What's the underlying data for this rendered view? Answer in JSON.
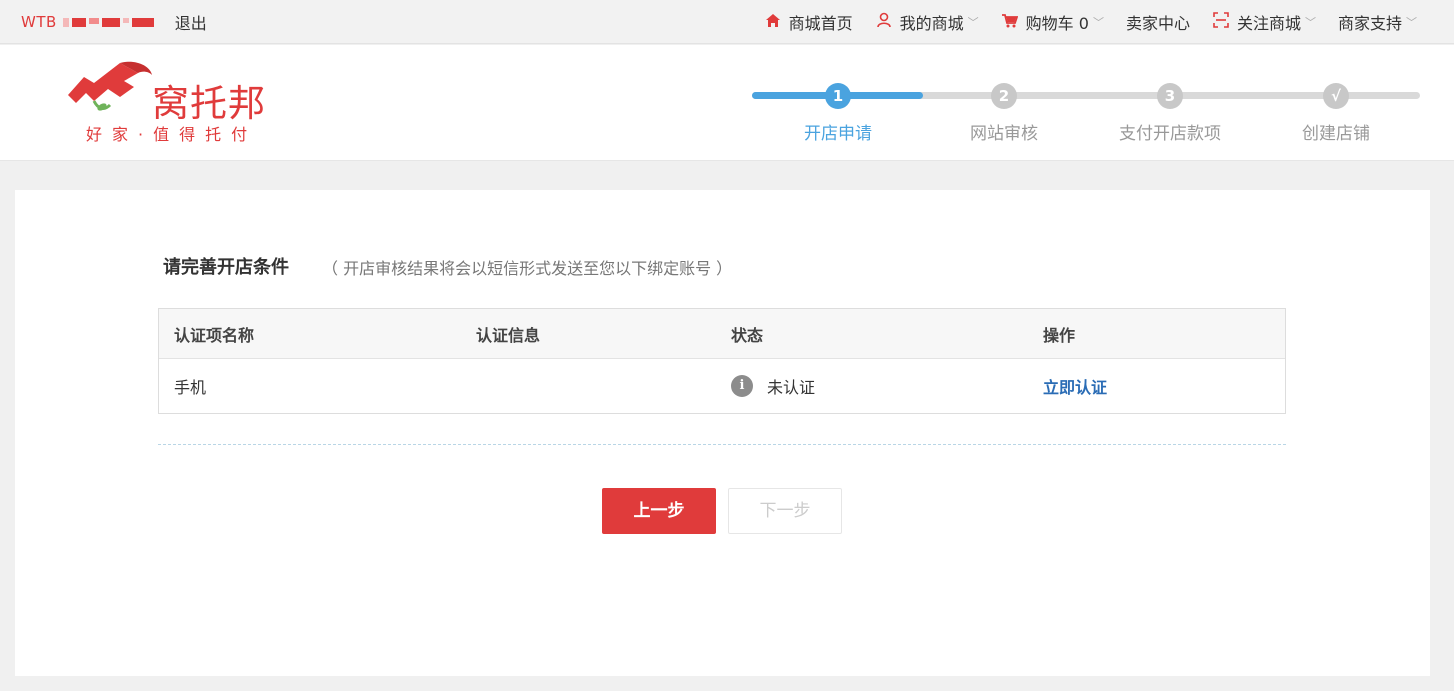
{
  "topbar": {
    "user_prefix": "WTB",
    "logout": "退出",
    "nav": [
      {
        "label": "商城首页",
        "icon": "home-icon"
      },
      {
        "label": "我的商城",
        "icon": "user-icon"
      },
      {
        "label": "购物车 0",
        "icon": "cart-icon"
      },
      {
        "label": "卖家中心"
      },
      {
        "label": "关注商城",
        "icon": "qrcode-icon"
      },
      {
        "label": "商家支持"
      }
    ]
  },
  "header": {
    "logo_name": "窝托邦",
    "logo_slogan": "好家·值得托付",
    "steps": [
      {
        "num": "1",
        "label": "开店申请",
        "active": true
      },
      {
        "num": "2",
        "label": "网站审核"
      },
      {
        "num": "3",
        "label": "支付开店款项"
      },
      {
        "num": "√",
        "label": "创建店铺"
      }
    ]
  },
  "main": {
    "title": "请完善开店条件",
    "note": "（ 开店审核结果将会以短信形式发送至您以下绑定账号 ）",
    "table": {
      "headers": [
        "认证项名称",
        "认证信息",
        "状态",
        "操作"
      ],
      "rows": [
        {
          "name": "手机",
          "info": "",
          "status": "未认证",
          "action": "立即认证"
        }
      ]
    },
    "prev_button": "上一步",
    "next_button": "下一步"
  },
  "colors": {
    "brand_red": "#e03b3b",
    "step_blue": "#4aa3df",
    "link_blue": "#2a6cb5"
  }
}
